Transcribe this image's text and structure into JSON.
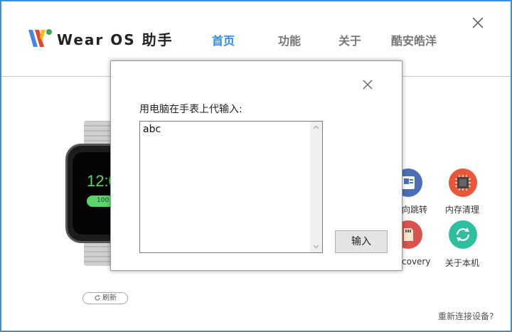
{
  "header": {
    "app_name": "Wear OS 助手",
    "nav": [
      {
        "label": "首页",
        "active": true
      },
      {
        "label": "功能",
        "active": false
      },
      {
        "label": "关于",
        "active": false
      },
      {
        "label": "酷安皓洋",
        "active": false
      }
    ]
  },
  "watch": {
    "time": "12:0",
    "pill": "100"
  },
  "functions": [
    {
      "label": "向跳转",
      "icon": "contact-card-icon",
      "color": "#4a6fb5"
    },
    {
      "label": "内存清理",
      "icon": "chip-icon",
      "color": "#e8573a"
    },
    {
      "label": "covery",
      "icon": "sd-card-icon",
      "color": "#d9534f"
    },
    {
      "label": "关于本机",
      "icon": "sync-icon",
      "color": "#2fbf9f"
    }
  ],
  "refresh_label": "刷新",
  "reconnect_label": "重新连接设备?",
  "dialog": {
    "label": "用电脑在手表上代输入:",
    "input_value": "abc",
    "submit_label": "输入"
  },
  "colors": {
    "accent": "#2e88e8",
    "border": "#3a8ee6"
  }
}
